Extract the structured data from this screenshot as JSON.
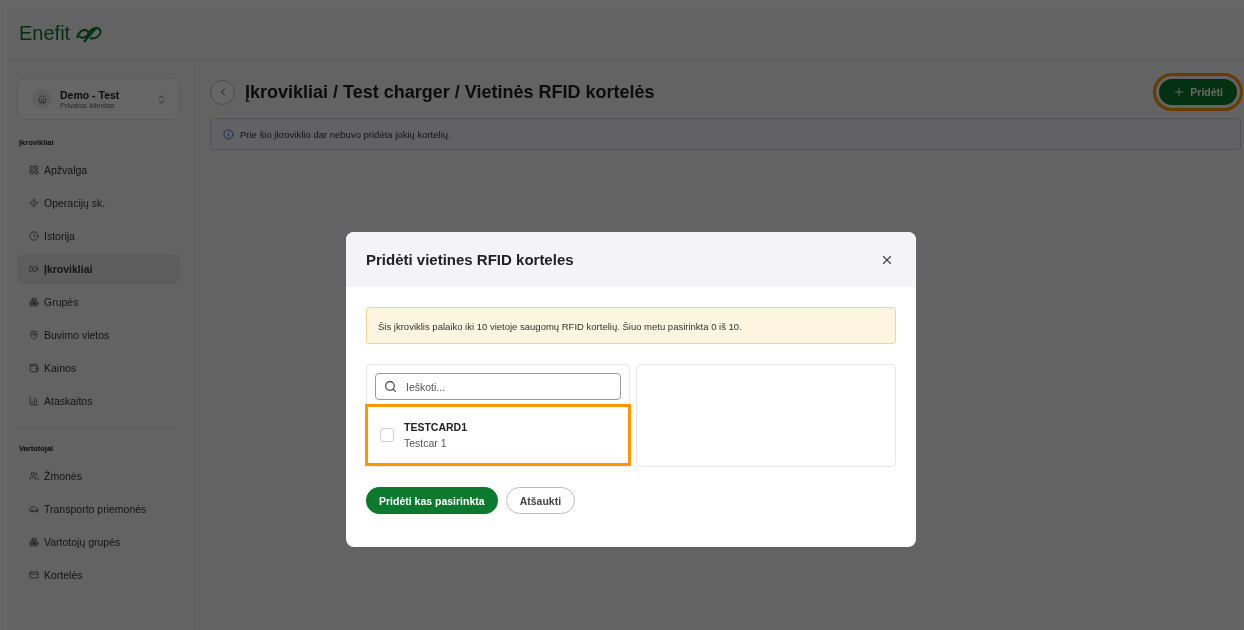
{
  "logo": {
    "text": "Enefit"
  },
  "account": {
    "name": "Demo - Test",
    "type": "Privatus klientas"
  },
  "sidebar": {
    "sections": [
      {
        "title": "Įkrovikliai",
        "items": [
          {
            "label": "Apžvalga",
            "selected": false
          },
          {
            "label": "Operacijų sk.",
            "selected": false
          },
          {
            "label": "Istorija",
            "selected": false
          },
          {
            "label": "Įkrovikliai",
            "selected": true
          },
          {
            "label": "Grupės",
            "selected": false
          },
          {
            "label": "Buvimo vietos",
            "selected": false
          },
          {
            "label": "Kainos",
            "selected": false
          },
          {
            "label": "Ataskaitos",
            "selected": false
          }
        ]
      },
      {
        "title": "Vartotojai",
        "items": [
          {
            "label": "Žmonės",
            "selected": false
          },
          {
            "label": "Transporto priemonės",
            "selected": false
          },
          {
            "label": "Vartotojų grupės",
            "selected": false
          },
          {
            "label": "Kortelės",
            "selected": false
          }
        ]
      }
    ]
  },
  "page": {
    "title": "Įkrovikliai / Test charger / Vietinės RFID kortelės",
    "add_button": {
      "label": "Pridėti",
      "highlighted": true
    },
    "info": "Prie šio įkroviklio dar nebuvo pridėta jokių kortelių."
  },
  "dialog": {
    "title": "Pridėti vietines RFID korteles",
    "notice": "Šis įkroviklis palaiko iki 10 vietoje saugomų RFID kortelių. Šiuo metu pasirinkta 0 iš 10.",
    "search": {
      "placeholder": "Ieškoti..."
    },
    "cards": [
      {
        "name": "TESTCARD1",
        "vehicle": "Testcar 1",
        "checked": false,
        "highlighted": true
      }
    ],
    "buttons": [
      {
        "label": "Pridėti kas pasirinkta",
        "kind": "primary"
      },
      {
        "label": "Atšaukti",
        "kind": "secondary"
      }
    ]
  }
}
